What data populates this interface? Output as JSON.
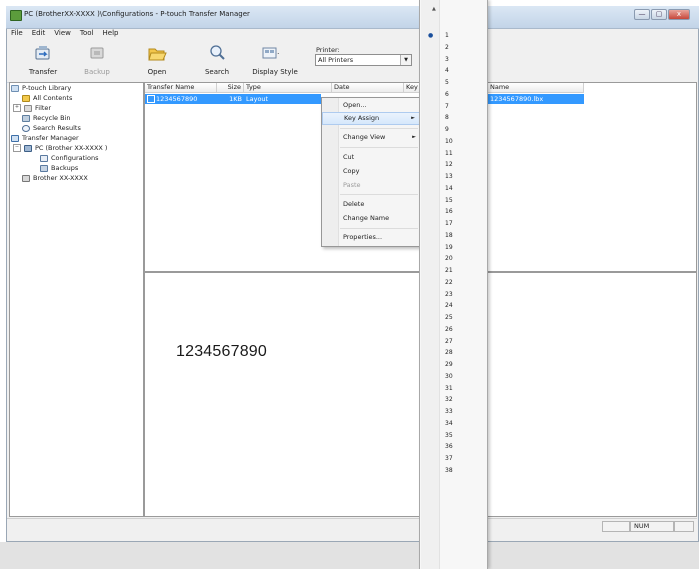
{
  "window": {
    "title": "PC (BrotherXX-XXXX )\\Configurations - P-touch Transfer Manager",
    "controls": [
      "—",
      "▢",
      "x"
    ]
  },
  "menu": [
    "File",
    "Edit",
    "View",
    "Tool",
    "Help"
  ],
  "toolbar": {
    "transfer": "Transfer",
    "backup": "Backup",
    "open": "Open",
    "search": "Search",
    "display_style": "Display Style",
    "printer_label": "Printer:",
    "printer_value": "All Printers"
  },
  "tree": {
    "library": "P-touch Library",
    "all_contents": "All Contents",
    "filter": "Filter",
    "recycle_bin": "Recycle Bin",
    "search_results": "Search Results",
    "transfer_manager": "Transfer Manager",
    "pc": "PC (Brother XX-XXXX )",
    "configurations": "Configurations",
    "backups": "Backups",
    "brother": "Brother XX-XXXX"
  },
  "list": {
    "columns": [
      "Transfer Name",
      "Size",
      "Type",
      "Date",
      "Key A",
      "Name"
    ],
    "row": {
      "name": "1234567890",
      "size": "1KB",
      "type": "Layout",
      "file": "1234567890.lbx"
    }
  },
  "preview": {
    "text": "1234567890"
  },
  "status": {
    "num": "NUM"
  },
  "context_menu": {
    "open": "Open...",
    "key_assign": "Key Assign",
    "change_view": "Change View",
    "cut": "Cut",
    "copy": "Copy",
    "paste": "Paste",
    "delete": "Delete",
    "change_name": "Change Name",
    "properties": "Properties..."
  },
  "key_assign_submenu": {
    "scroll_up": "▲",
    "checked": "●",
    "items": [
      "1",
      "2",
      "3",
      "4",
      "5",
      "6",
      "7",
      "8",
      "9",
      "10",
      "11",
      "12",
      "13",
      "14",
      "15",
      "16",
      "17",
      "18",
      "19",
      "20",
      "21",
      "22",
      "23",
      "24",
      "25",
      "26",
      "27",
      "28",
      "29",
      "30",
      "31",
      "32",
      "33",
      "34",
      "35",
      "36",
      "37",
      "38"
    ]
  }
}
